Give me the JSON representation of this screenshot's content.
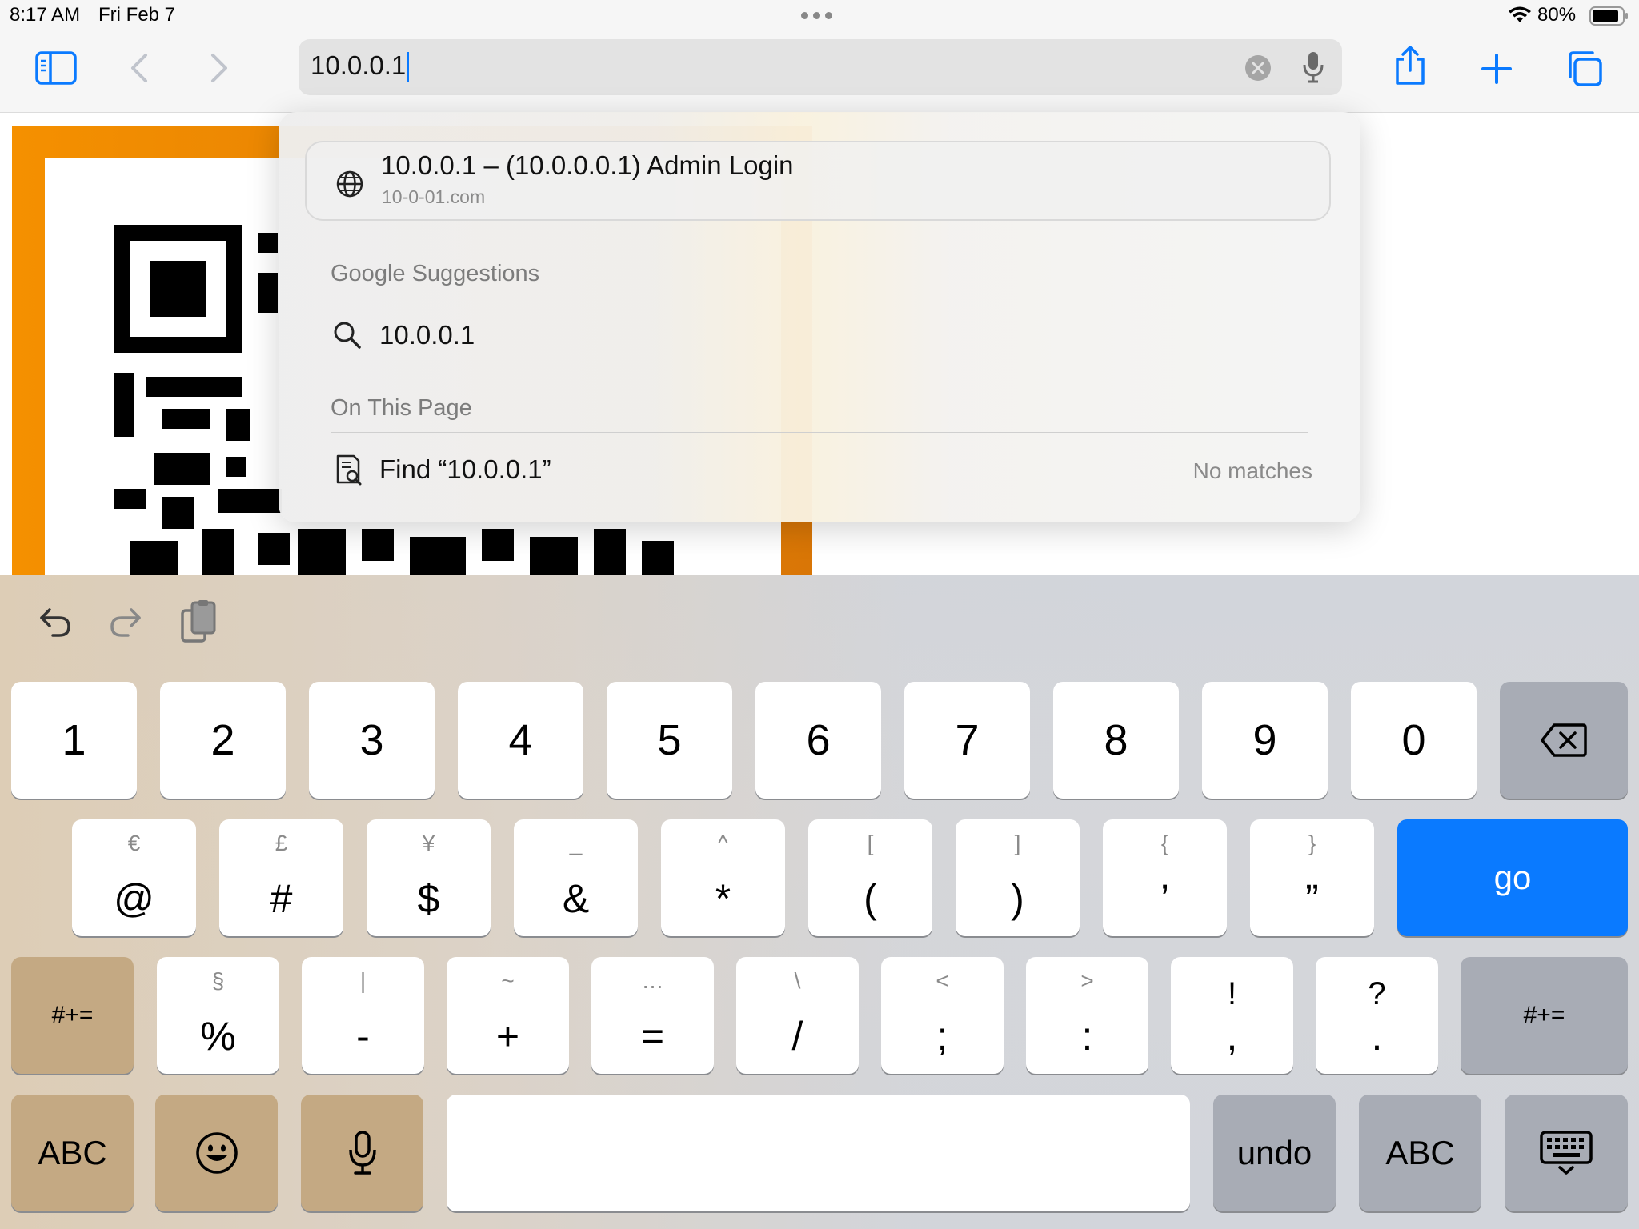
{
  "status": {
    "time": "8:17 AM",
    "date": "Fri Feb 7",
    "battery": "80%"
  },
  "toolbar": {
    "url_value": "10.0.0.1",
    "icons": [
      "sidebar-icon",
      "back-icon",
      "forward-icon",
      "clear-icon",
      "mic-icon",
      "share-icon",
      "new-tab-icon",
      "tabs-icon"
    ]
  },
  "dropdown": {
    "top_hit": {
      "title": "10.0.0.1 – (10.0.0.0.1) Admin Login",
      "url": "10-0-01.com"
    },
    "google_title": "Google Suggestions",
    "google_suggestion": "10.0.0.1",
    "onpage_title": "On This Page",
    "find_label": "Find “10.0.0.1”",
    "find_status": "No matches"
  },
  "keyboard": {
    "number_row": [
      "1",
      "2",
      "3",
      "4",
      "5",
      "6",
      "7",
      "8",
      "9",
      "0"
    ],
    "row2": [
      {
        "sub": "€",
        "main": "@"
      },
      {
        "sub": "£",
        "main": "#"
      },
      {
        "sub": "¥",
        "main": "$"
      },
      {
        "sub": "_",
        "main": "&"
      },
      {
        "sub": "^",
        "main": "*"
      },
      {
        "sub": "[",
        "main": "("
      },
      {
        "sub": "]",
        "main": ")"
      },
      {
        "sub": "{",
        "main": "’"
      },
      {
        "sub": "}",
        "main": "”"
      }
    ],
    "go": "go",
    "row3": [
      {
        "sub": "§",
        "main": "%"
      },
      {
        "sub": "|",
        "main": "-"
      },
      {
        "sub": "~",
        "main": "+"
      },
      {
        "sub": "…",
        "main": "="
      },
      {
        "sub": "\\",
        "main": "/"
      },
      {
        "sub": "<",
        "main": ";"
      },
      {
        "sub": ">",
        "main": ":"
      },
      {
        "sub": "!",
        "main": ","
      },
      {
        "sub": "?",
        "main": "."
      }
    ],
    "shift_label": "#+=",
    "abc_label": "ABC",
    "undo_label": "undo"
  }
}
